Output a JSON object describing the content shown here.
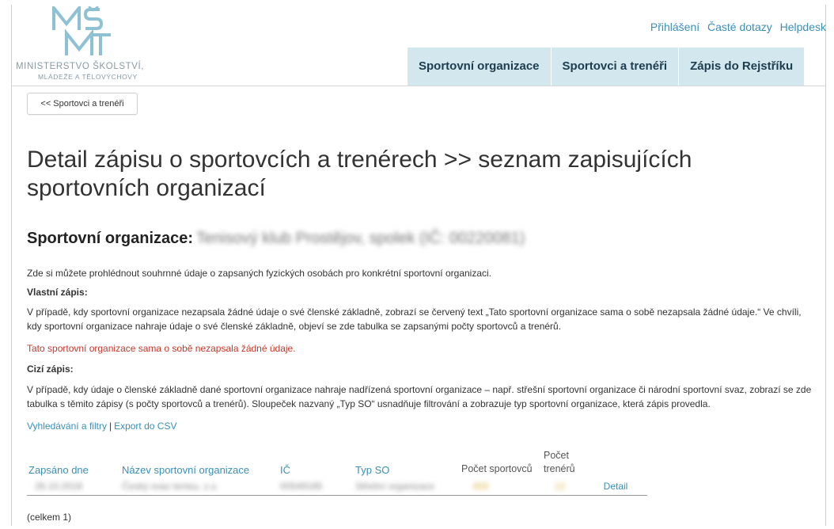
{
  "logo": {
    "line1": "MINISTERSTVO ŠKOLSTVÍ,",
    "line2": "MLÁDEŽE A TĚLOVÝCHOVY",
    "mark": "MŠMT",
    "color": "#8a9aa3"
  },
  "top_links": [
    "Přihlášení",
    "Časté dotazy",
    "Helpdesk"
  ],
  "nav": [
    "Sportovní organizace",
    "Sportovci a trenéři",
    "Zápis do Rejstříku"
  ],
  "back_button": "<< Sportovci a trenéři",
  "title": "Detail zápisu o sportovcích a trenérech >> seznam zapisujících sportovních organizací",
  "org_heading": "Sportovní organizace:",
  "org_name_blurred": "Tenisový klub Prostějov, spolek (IČ: 00220081)",
  "intro": "Zde si můžete prohlédnout souhrnné údaje o zapsaných fyzických osobách pro konkrétní sportovní organizaci.",
  "own": {
    "heading": "Vlastní zápis:",
    "text": "V případě, kdy sportovní organizace nezapsala žádné údaje o své členské základně, zobrazí se červený text „Tato sportovní organizace sama o sobě nezapsala žádné údaje.“ Ve chvíli, kdy sportovní organizace nahraje údaje o své členské základně, objeví se zde tabulka se zapsanými počty sportovců a trenérů.",
    "notice": "Tato sportovní organizace sama o sobě nezapsala žádné údaje."
  },
  "foreign": {
    "heading": "Cizí zápis:",
    "text": "V případě, kdy údaje o členské základně dané sportovní organizace nahraje nadřízená sportovní organizace – např. střešní sportovní organizace či národní sportovní svaz, zobrazí se zde tabulka s těmito zápisy (s počty sportovců a trenérů). Sloupeček nazvaný „Typ SO“ usnadňuje filtrování a zobrazuje typ sportovní organizace, která zápis provedla."
  },
  "links": {
    "search": "Vyhledávání a filtry",
    "separator": "|",
    "export": "Export do CSV"
  },
  "table": {
    "headers": [
      "Zapsáno dne",
      "Název sportovní organizace",
      "IČ",
      "Typ SO",
      "Počet sportovců",
      "Počet trenérů"
    ],
    "row": {
      "date": "26.10.2018",
      "name": "Český svaz tenisu, z.s.",
      "ic": "00549185",
      "type": "Střešní organizace",
      "athletes": "458",
      "trainers": "12",
      "detail": "Detail"
    }
  },
  "total": "(celkem 1)",
  "colors": {
    "link": "#3a8fb7",
    "nav_bg": "#d3e7ee",
    "notice": "#c0392b"
  }
}
